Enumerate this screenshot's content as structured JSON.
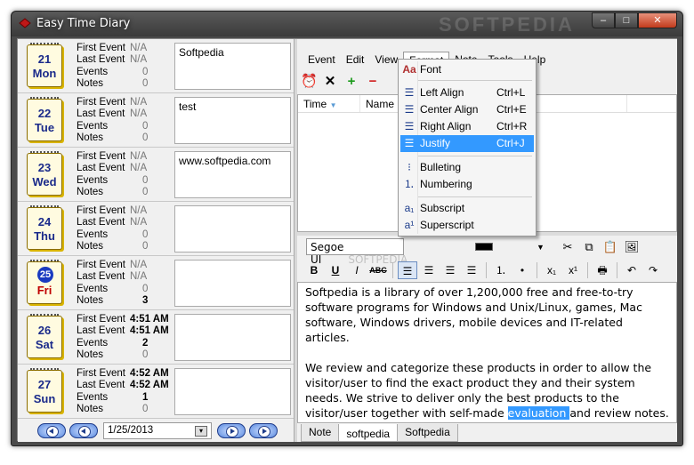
{
  "window": {
    "title": "Easy Time Diary",
    "watermark": "SOFTPEDIA",
    "buttons": {
      "minimize": "–",
      "maximize": "□",
      "close": "✕"
    }
  },
  "days": [
    {
      "num": "21",
      "name": "Mon",
      "first": "N/A",
      "last": "N/A",
      "events": "0",
      "notes": "0",
      "note_text": "Softpedia",
      "today": false
    },
    {
      "num": "22",
      "name": "Tue",
      "first": "N/A",
      "last": "N/A",
      "events": "0",
      "notes": "0",
      "note_text": "test",
      "today": false
    },
    {
      "num": "23",
      "name": "Wed",
      "first": "N/A",
      "last": "N/A",
      "events": "0",
      "notes": "0",
      "note_text": "www.softpedia.com",
      "today": false
    },
    {
      "num": "24",
      "name": "Thu",
      "first": "N/A",
      "last": "N/A",
      "events": "0",
      "notes": "0",
      "note_text": "",
      "today": false
    },
    {
      "num": "25",
      "name": "Fri",
      "first": "N/A",
      "last": "N/A",
      "events": "0",
      "notes": "3",
      "note_text": "",
      "today": true
    },
    {
      "num": "26",
      "name": "Sat",
      "first": "4:51 AM",
      "last": "4:51 AM",
      "events": "2",
      "notes": "0",
      "note_text": "",
      "today": false
    },
    {
      "num": "27",
      "name": "Sun",
      "first": "4:52 AM",
      "last": "4:52 AM",
      "events": "1",
      "notes": "0",
      "note_text": "",
      "today": false
    }
  ],
  "labels": {
    "first": "First Event",
    "last": "Last Event",
    "events": "Events",
    "notes": "Notes"
  },
  "nav": {
    "date": "1/25/2013"
  },
  "menu": [
    "Event",
    "Edit",
    "View",
    "Format",
    "Note",
    "Tools",
    "Help"
  ],
  "event_list": {
    "columns": [
      "Time",
      "Name"
    ]
  },
  "font": {
    "name": "Segoe UI",
    "watermark": "SOFTPEDIA"
  },
  "format_menu": {
    "items": [
      {
        "label": "Font",
        "shortcut": "",
        "icon": "font-icon"
      },
      {
        "label": "Left Align",
        "shortcut": "Ctrl+L",
        "icon": "align-left-icon"
      },
      {
        "label": "Center Align",
        "shortcut": "Ctrl+E",
        "icon": "align-center-icon"
      },
      {
        "label": "Right Align",
        "shortcut": "Ctrl+R",
        "icon": "align-right-icon"
      },
      {
        "label": "Justify",
        "shortcut": "Ctrl+J",
        "icon": "justify-icon"
      },
      {
        "label": "Bulleting",
        "shortcut": "",
        "icon": "bullet-list-icon"
      },
      {
        "label": "Numbering",
        "shortcut": "",
        "icon": "number-list-icon"
      },
      {
        "label": "Subscript",
        "shortcut": "",
        "icon": "subscript-icon"
      },
      {
        "label": "Superscript",
        "shortcut": "",
        "icon": "superscript-icon"
      }
    ],
    "highlighted": "Justify"
  },
  "editor": {
    "para1": "Softpedia is a library of over 1,200,000 free and free-to-try software programs for Windows and Unix/Linux, games, Mac software, Windows drivers, mobile devices and IT-related articles.",
    "para2_before": "We review and categorize these products in order to allow the visitor/user to find the exact product they and their system needs. We strive to deliver only the best products to the visitor/user together with self-made ",
    "para2_highlight": "evaluation ",
    "para2_after": "and review notes."
  },
  "tabs": [
    "Note",
    "softpedia",
    "Softpedia"
  ],
  "colors": {
    "highlight": "#3399ff",
    "day_text": "#1a2a8a",
    "today_text": "#c00000"
  }
}
